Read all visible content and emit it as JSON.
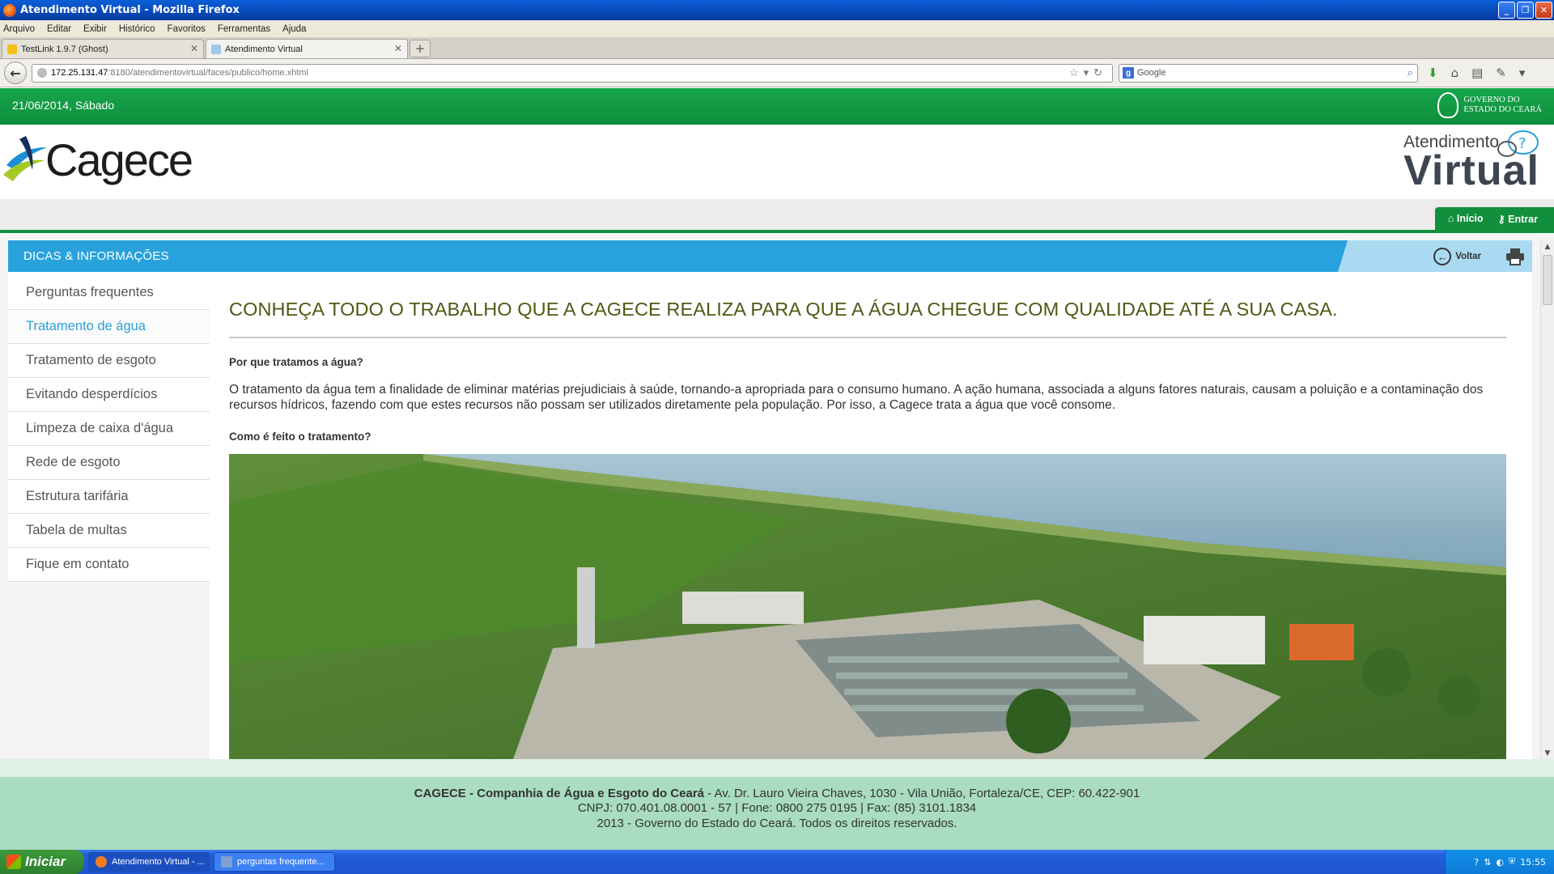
{
  "window": {
    "title": "Atendimento Virtual - Mozilla Firefox"
  },
  "menubar": [
    "Arquivo",
    "Editar",
    "Exibir",
    "Histórico",
    "Favoritos",
    "Ferramentas",
    "Ajuda"
  ],
  "tabs": [
    {
      "label": "TestLink 1.9.7 (Ghost)"
    },
    {
      "label": "Atendimento Virtual"
    }
  ],
  "url": {
    "host": "172.25.131.47",
    "path": ":8180/atendimentovirtual/faces/publico/home.xhtml"
  },
  "search": {
    "placeholder": "Google"
  },
  "page": {
    "date": "21/06/2014, Sábado",
    "gov_line1": "Governo do",
    "gov_line2": "Estado do Ceará",
    "logo_text": "Cagece",
    "av_line1": "Atendimento",
    "av_line2": "Virtual",
    "nav_inicio": "Início",
    "nav_entrar": "Entrar",
    "section_title": "DICAS & INFORMAÇÕES",
    "voltar": "Voltar",
    "sidebar": [
      "Perguntas frequentes",
      "Tratamento de água",
      "Tratamento de esgoto",
      "Evitando desperdícios",
      "Limpeza de caixa d'água",
      "Rede de esgoto",
      "Estrutura tarifária",
      "Tabela de multas",
      "Fique em contato"
    ],
    "heading": "CONHEÇA TODO O TRABALHO QUE A CAGECE REALIZA PARA QUE A ÁGUA CHEGUE COM QUALIDADE ATÉ A SUA CASA.",
    "q1": "Por que tratamos a água?",
    "p1": "O tratamento da água tem a finalidade de eliminar matérias prejudiciais à saúde, tornando-a apropriada para o consumo humano. A ação humana, associada a alguns fatores naturais, causam a poluição e a contaminação dos recursos hídricos, fazendo com que estes recursos não possam ser utilizados diretamente pela população. Por isso, a Cagece trata a água que você consome.",
    "q2": "Como é feito o tratamento?"
  },
  "footer": {
    "company": "CAGECE - Companhia de Água e Esgoto do Ceará",
    "address": " - Av. Dr. Lauro Vieira Chaves, 1030 - Vila União, Fortaleza/CE, CEP: 60.422-901",
    "line2": "CNPJ: 070.401.08.0001 - 57 | Fone: 0800 275 0195 | Fax: (85) 3101.1834",
    "line3": "2013 - Governo do Estado do Ceará. Todos os direitos reservados."
  },
  "taskbar": {
    "start": "Iniciar",
    "tasks": [
      "Atendimento Virtual - ...",
      "perguntas frequente..."
    ],
    "clock": "15:55"
  }
}
